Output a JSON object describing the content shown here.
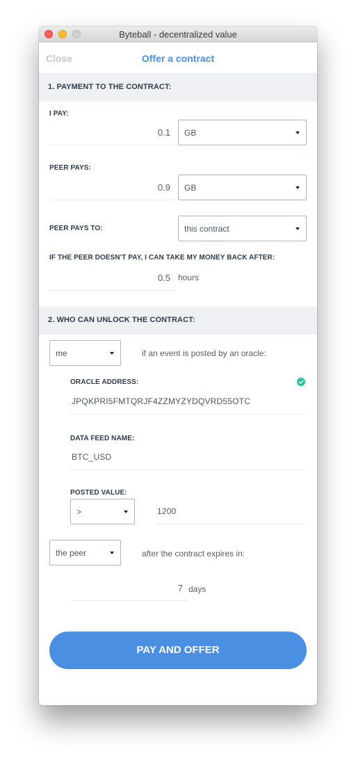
{
  "window": {
    "title": "Byteball - decentralized value"
  },
  "header": {
    "close_label": "Close",
    "title": "Offer a contract"
  },
  "section1": {
    "title": "1. PAYMENT TO THE CONTRACT:",
    "i_pay": {
      "label": "I PAY:",
      "amount": "0.1",
      "asset": "GB"
    },
    "peer_pays": {
      "label": "PEER PAYS:",
      "amount": "0.9",
      "asset": "GB"
    },
    "peer_pays_to": {
      "label": "PEER PAYS TO:",
      "value": "this contract"
    },
    "timeout": {
      "label": "IF THE PEER DOESN'T PAY, I CAN TAKE MY MONEY BACK AFTER:",
      "value": "0.5",
      "unit": "hours"
    }
  },
  "section2": {
    "title": "2. WHO CAN UNLOCK THE CONTRACT:",
    "party1": {
      "value": "me",
      "condition_text": "if an event is posted by an oracle:"
    },
    "oracle_address": {
      "label": "ORACLE ADDRESS:",
      "value": "JPQKPRI5FMTQRJF4ZZMYZYDQVRD55OTC"
    },
    "feed_name": {
      "label": "DATA FEED NAME:",
      "value": "BTC_USD"
    },
    "posted_value": {
      "label": "POSTED VALUE:",
      "relation": ">",
      "value": "1200"
    },
    "party2": {
      "value": "the peer",
      "condition_text": "after the contract expires in:"
    },
    "expiry": {
      "value": "7",
      "unit": "days"
    }
  },
  "actions": {
    "pay_label": "PAY AND OFFER"
  },
  "colors": {
    "accent": "#4a90e2",
    "valid": "#26c19b"
  },
  "icons": {
    "valid": "check-circle-icon",
    "dropdown": "caret-down-icon"
  }
}
